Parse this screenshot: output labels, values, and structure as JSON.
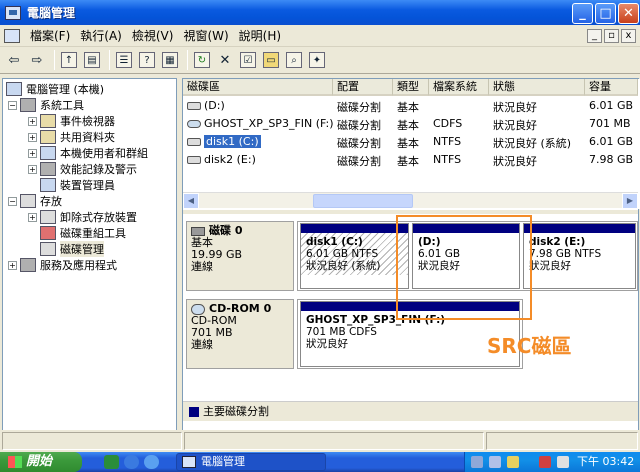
{
  "window": {
    "title": "電腦管理",
    "min": "_",
    "max": "□",
    "close": "✕"
  },
  "menu": [
    {
      "label": "檔案(F)"
    },
    {
      "label": "執行(A)"
    },
    {
      "label": "檢視(V)"
    },
    {
      "label": "視窗(W)"
    },
    {
      "label": "說明(H)"
    }
  ],
  "mdi": {
    "min": "_",
    "restore": "▫",
    "close": "x"
  },
  "tree": {
    "root": "電腦管理 (本機)",
    "system_tools": "系統工具",
    "event_viewer": "事件檢視器",
    "shared_folders": "共用資料夾",
    "local_users": "本機使用者和群組",
    "perf_logs": "效能記錄及警示",
    "device_manager": "裝置管理員",
    "storage": "存放",
    "removable_storage": "卸除式存放裝置",
    "defrag": "磁碟重組工具",
    "disk_mgmt": "磁碟管理",
    "services_apps": "服務及應用程式"
  },
  "volume_list": {
    "headers": [
      "磁碟區",
      "配置",
      "類型",
      "檔案系統",
      "狀態",
      "容量"
    ],
    "rows": [
      {
        "name": "(D:)",
        "layout": "磁碟分割",
        "type": "基本",
        "fs": "",
        "status": "狀況良好",
        "capacity": "6.01 GB"
      },
      {
        "name": "GHOST_XP_SP3_FIN (F:)",
        "layout": "磁碟分割",
        "type": "基本",
        "fs": "CDFS",
        "status": "狀況良好",
        "capacity": "701 MB"
      },
      {
        "name": "disk1 (C:)",
        "layout": "磁碟分割",
        "type": "基本",
        "fs": "NTFS",
        "status": "狀況良好 (系統)",
        "capacity": "6.01 GB"
      },
      {
        "name": "disk2 (E:)",
        "layout": "磁碟分割",
        "type": "基本",
        "fs": "NTFS",
        "status": "狀況良好",
        "capacity": "7.98 GB"
      }
    ]
  },
  "disks": [
    {
      "title": "磁碟 0",
      "type": "基本",
      "size": "19.99 GB",
      "state": "連線",
      "partitions": [
        {
          "name": "disk1  (C:)",
          "size": "6.01 GB NTFS",
          "status": "狀況良好 (系統)"
        },
        {
          "name": "(D:)",
          "size": "6.01 GB",
          "status": "狀況良好"
        },
        {
          "name": "disk2  (E:)",
          "size": "7.98 GB NTFS",
          "status": "狀況良好"
        }
      ]
    },
    {
      "title": "CD-ROM 0",
      "type": "CD-ROM",
      "size": "701 MB",
      "state": "連線",
      "partitions": [
        {
          "name": "GHOST_XP_SP3_FIN  (F:)",
          "size": "701 MB CDFS",
          "status": "狀況良好"
        }
      ]
    }
  ],
  "legend": {
    "label": "主要磁碟分割",
    "color": "#000080"
  },
  "annotation": {
    "label": "SRC磁區",
    "color": "#f48c28"
  },
  "taskbar": {
    "start": "開始",
    "task": "電腦管理",
    "clock": "下午 03:42"
  }
}
